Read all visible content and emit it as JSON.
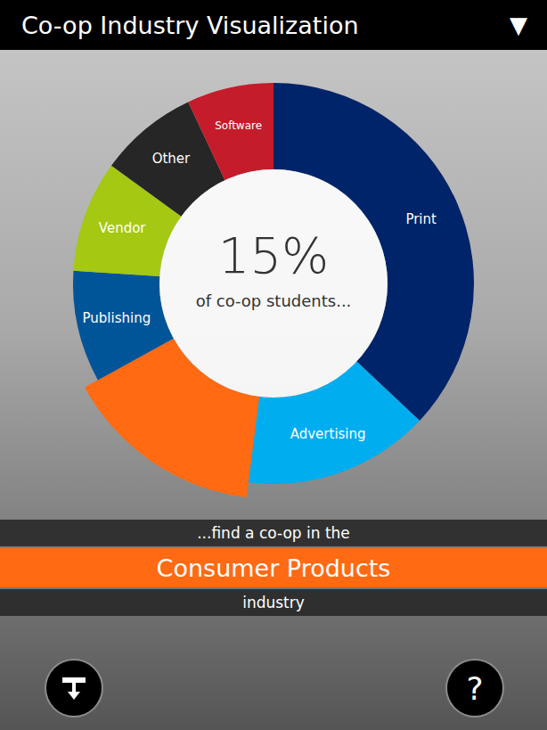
{
  "header": {
    "title": "Co-op Industry Visualization",
    "menu_icon": "▼"
  },
  "chart": {
    "segments": [
      {
        "label": "Print",
        "value": 37,
        "color": "#002469",
        "selected": false
      },
      {
        "label": "Advertising",
        "value": 15,
        "color": "#00adef",
        "selected": false
      },
      {
        "label": "Consumer Products",
        "value": 15,
        "color": "#ff6a13",
        "selected": true
      },
      {
        "label": "Publishing",
        "value": 9,
        "color": "#005599",
        "selected": false
      },
      {
        "label": "Vendor",
        "value": 9,
        "color": "#a5c812",
        "selected": false
      },
      {
        "label": "Other",
        "value": 8,
        "color": "#262626",
        "selected": false
      },
      {
        "label": "Software",
        "value": 7,
        "color": "#c41c2b",
        "selected": false
      }
    ],
    "center": {
      "value": "15%",
      "caption": "of co-op students..."
    }
  },
  "caption": {
    "lead": "...find a co-op in the",
    "industry": "Consumer Products",
    "trail": "industry"
  },
  "buttons": {
    "help": "?"
  }
}
